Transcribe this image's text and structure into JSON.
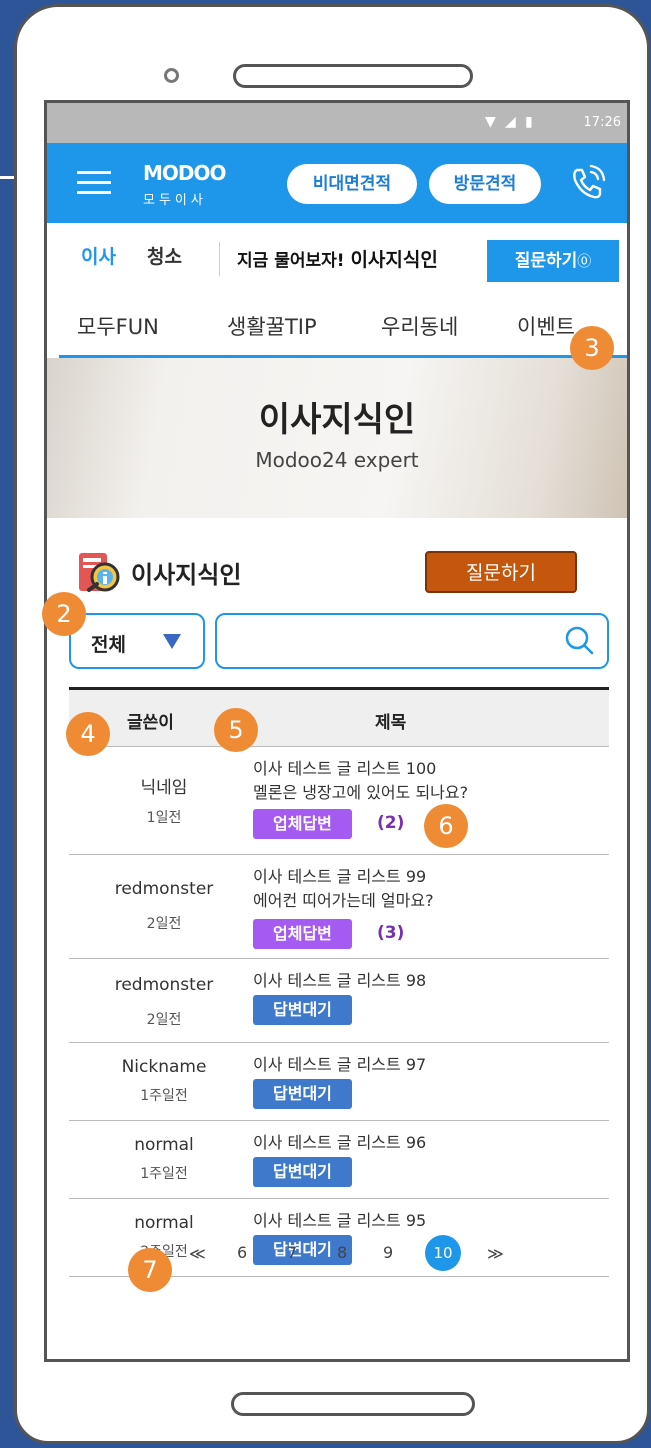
{
  "status": {
    "time": "17:26"
  },
  "header": {
    "logo_en": "MODOO",
    "logo_ko": "모두이사",
    "btn_remote": "비대면견적",
    "btn_visit": "방문견적"
  },
  "category": {
    "move": "이사",
    "clean": "청소",
    "ask_prefix": "지금 물어보자!",
    "ask_brand": "이사지식인",
    "ask_button": "질문하기"
  },
  "menu": [
    "모두FUN",
    "생활꿀TIP",
    "우리동네",
    "이벤트"
  ],
  "banner": {
    "title": "이사지식인",
    "subtitle": "Modoo24 expert"
  },
  "section": {
    "title": "이사지식인",
    "question_button": "질문하기"
  },
  "filter": {
    "selected": "전체",
    "search_placeholder": ""
  },
  "table": {
    "headers": {
      "author": "글쓴이",
      "title": "제목"
    },
    "rows": [
      {
        "author": "닉네임",
        "date": "1일전",
        "title": "이사 테스트 글 리스트 100",
        "question": "멜론은 냉장고에 있어도 되나요?",
        "badge": "업체답변",
        "count": "(2)"
      },
      {
        "author": "redmonster",
        "date": "2일전",
        "title": "이사 테스트 글 리스트 99",
        "question": "에어컨 띠어가는데 얼마요?",
        "badge": "업체답변",
        "count": "(3)"
      },
      {
        "author": "redmonster",
        "date": "2일전",
        "title": "이사 테스트 글 리스트 98",
        "badge": "답변대기"
      },
      {
        "author": "Nickname",
        "date": "1주일전",
        "title": "이사 테스트 글 리스트 97",
        "badge": "답변대기"
      },
      {
        "author": "normal",
        "date": "1주일전",
        "title": "이사 테스트 글 리스트 96",
        "badge": "답변대기"
      },
      {
        "author": "normal",
        "date": "2주일전",
        "title": "이사 테스트 글 리스트 95",
        "badge": "답변대기"
      }
    ]
  },
  "pagination": {
    "prev": "≪",
    "pages": [
      "6",
      "7",
      "8",
      "9",
      "10"
    ],
    "current": "10",
    "next": "≫"
  },
  "annotations": [
    "2",
    "3",
    "4",
    "5",
    "6",
    "7"
  ],
  "colors": {
    "primary": "#1e96ea",
    "accent": "#c4570d",
    "badge_answer": "#a55bf2",
    "badge_wait": "#3f79cc",
    "annotation": "#ef8a35"
  }
}
